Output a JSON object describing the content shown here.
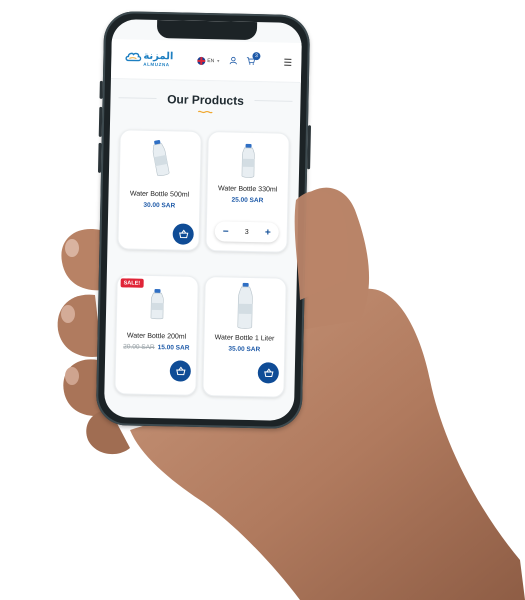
{
  "header": {
    "logo_ar": "المزنة",
    "logo_en": "ALMUZNA",
    "language": "EN",
    "cart_count": "3"
  },
  "section": {
    "title": "Our Products"
  },
  "products": [
    {
      "name": "Water Bottle 500ml",
      "price": "30.00 SAR",
      "old_price": "",
      "badge": ""
    },
    {
      "name": "Water Bottle 330ml",
      "price": "25.00 SAR",
      "old_price": "",
      "badge": "",
      "quantity": "3"
    },
    {
      "name": "Water Bottle 200ml",
      "price": "15.00 SAR",
      "old_price": "20.00 SAR",
      "badge": "SALE!"
    },
    {
      "name": "Water Bottle 1 Liter",
      "price": "35.00 SAR",
      "old_price": "",
      "badge": ""
    }
  ],
  "colors": {
    "brand_blue": "#0f4c96",
    "logo_blue": "#1e7fc1",
    "sale_red": "#e02538"
  },
  "icons": {
    "cart": "basket-icon",
    "user": "user-icon",
    "menu": "hamburger-menu-icon",
    "language": "uk-flag-icon"
  }
}
